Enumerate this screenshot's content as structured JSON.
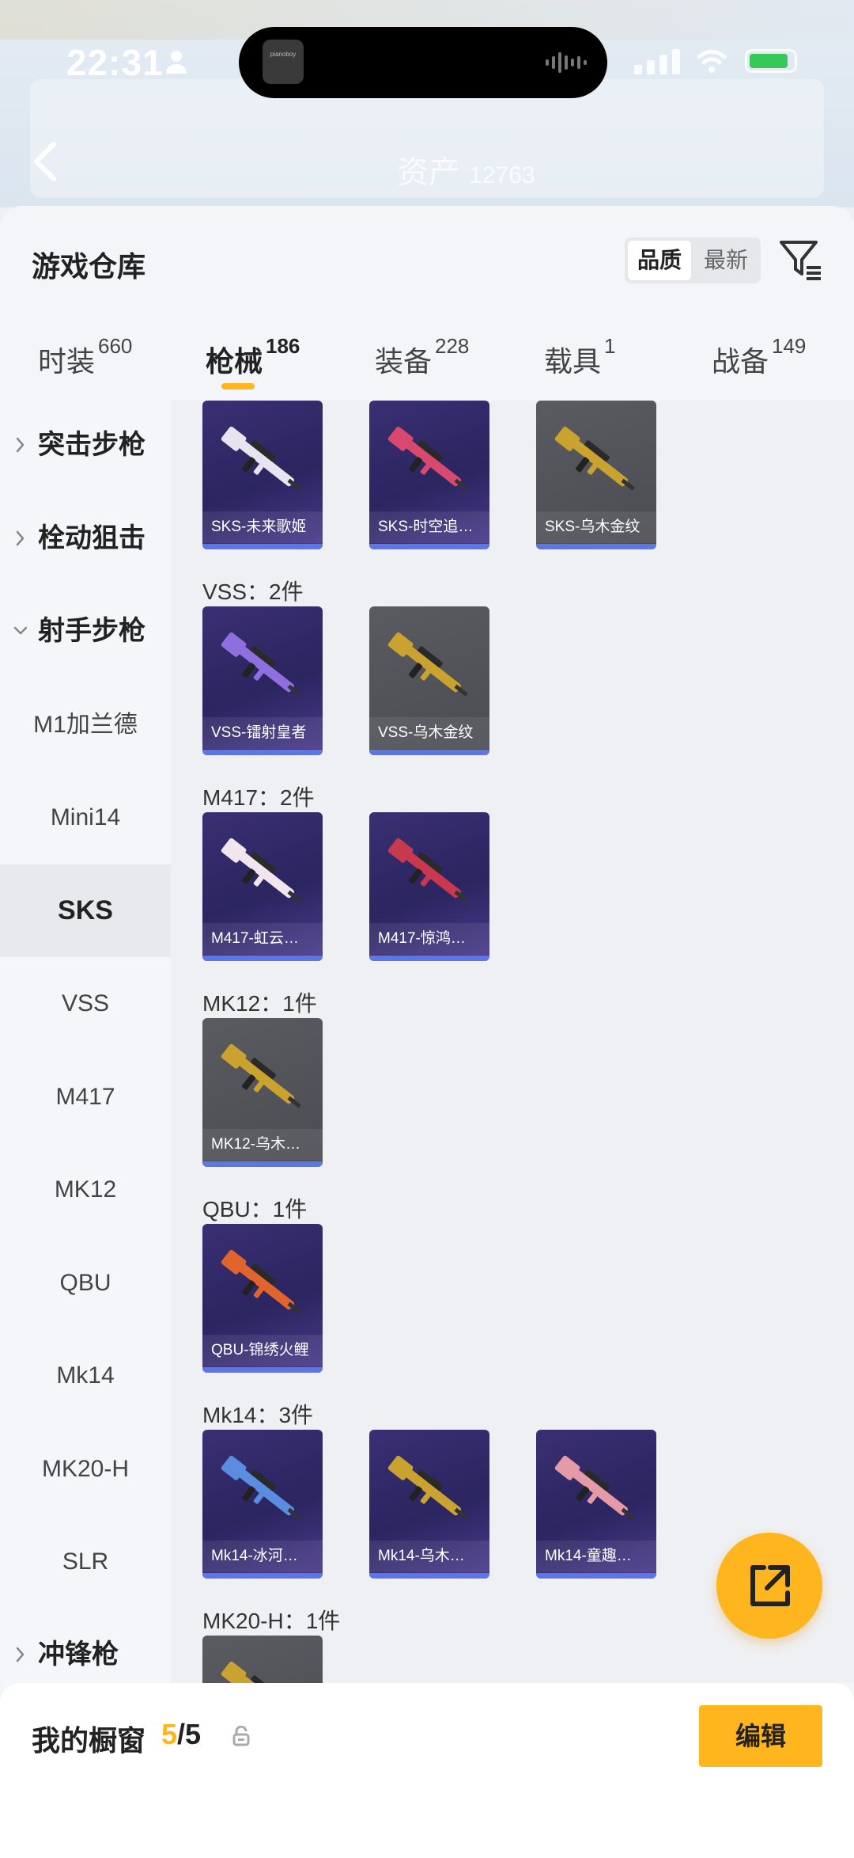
{
  "status_bar": {
    "time": "22:31",
    "island_thumb_text": "pianoboy",
    "battery_color": "#38c759"
  },
  "header": {
    "asset_label": "资产",
    "asset_value": "12763"
  },
  "warehouse": {
    "title": "游戏仓库",
    "sort": {
      "quality": "品质",
      "newest": "最新",
      "selected": "品质"
    },
    "tabs": [
      {
        "label": "时装",
        "count": "660"
      },
      {
        "label": "枪械",
        "count": "186",
        "active": true
      },
      {
        "label": "装备",
        "count": "228"
      },
      {
        "label": "载具",
        "count": "1"
      },
      {
        "label": "战备",
        "count": "149"
      }
    ]
  },
  "sidebar": {
    "items": [
      {
        "label": "突击步枪",
        "type": "category",
        "expanded": false
      },
      {
        "label": "栓动狙击",
        "type": "category",
        "expanded": false
      },
      {
        "label": "射手步枪",
        "type": "category",
        "expanded": true
      },
      {
        "label": "M1加兰德",
        "type": "sub"
      },
      {
        "label": "Mini14",
        "type": "sub"
      },
      {
        "label": "SKS",
        "type": "sub",
        "selected": true
      },
      {
        "label": "VSS",
        "type": "sub"
      },
      {
        "label": "M417",
        "type": "sub"
      },
      {
        "label": "MK12",
        "type": "sub"
      },
      {
        "label": "QBU",
        "type": "sub"
      },
      {
        "label": "Mk14",
        "type": "sub"
      },
      {
        "label": "MK20-H",
        "type": "sub"
      },
      {
        "label": "SLR",
        "type": "sub"
      },
      {
        "label": "冲锋枪",
        "type": "category",
        "expanded": false
      }
    ]
  },
  "groups": [
    {
      "label": "",
      "items": [
        {
          "name": "SKS-未来歌姬",
          "style": "purple",
          "gun_color": "#e8e4ef"
        },
        {
          "name": "SKS-时空追…",
          "style": "purple",
          "gun_color": "#d9486f"
        },
        {
          "name": "SKS-乌木金纹",
          "style": "gray",
          "gun_color": "#c9a230"
        }
      ]
    },
    {
      "label": "VSS：2件",
      "items": [
        {
          "name": "VSS-镭射皇者",
          "style": "purple",
          "gun_color": "#8f6ee0"
        },
        {
          "name": "VSS-乌木金纹",
          "style": "gray",
          "gun_color": "#c9a230"
        }
      ]
    },
    {
      "label": "M417：2件",
      "items": [
        {
          "name": "M417-虹云…",
          "style": "purple",
          "gun_color": "#f1e6ee"
        },
        {
          "name": "M417-惊鸿…",
          "style": "purple",
          "gun_color": "#c8384f"
        }
      ]
    },
    {
      "label": "MK12：1件",
      "items": [
        {
          "name": "MK12-乌木…",
          "style": "gray",
          "gun_color": "#c9a230"
        }
      ]
    },
    {
      "label": "QBU：1件",
      "items": [
        {
          "name": "QBU-锦绣火鲤",
          "style": "purple",
          "gun_color": "#e0642e"
        }
      ]
    },
    {
      "label": "Mk14：3件",
      "items": [
        {
          "name": "Mk14-冰河…",
          "style": "purple",
          "gun_color": "#5a8de0"
        },
        {
          "name": "Mk14-乌木…",
          "style": "purple",
          "gun_color": "#c9a230"
        },
        {
          "name": "Mk14-童趣…",
          "style": "purple",
          "gun_color": "#e59aa8"
        }
      ]
    },
    {
      "label": "MK20-H：1件",
      "items": [
        {
          "name": "",
          "style": "gray",
          "gun_color": "#c9a230"
        }
      ]
    }
  ],
  "showcase": {
    "label": "我的橱窗",
    "count": "5",
    "total": "/5",
    "edit": "编辑"
  },
  "colors": {
    "accent": "#ffb51e",
    "rarity_bar": "#5b76e8"
  }
}
